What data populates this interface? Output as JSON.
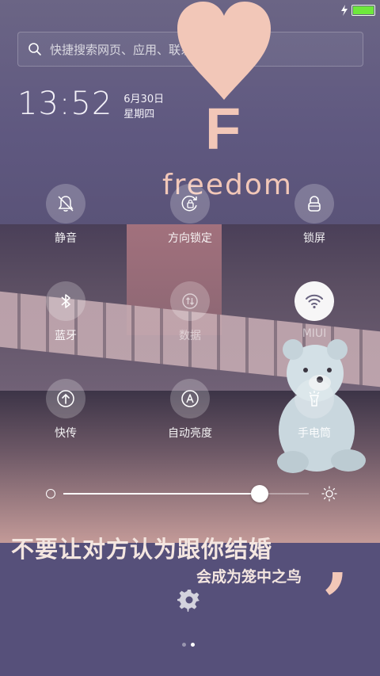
{
  "search": {
    "placeholder": "快捷搜索网页、应用、联系人、视频..."
  },
  "clock": {
    "time": "13:52",
    "date": "6月30日",
    "weekday": "星期四"
  },
  "wallpaper": {
    "letter": "F",
    "word": "freedom",
    "quote_line1": "不要让对方认为跟你结婚",
    "quote_line2": "会成为笼中之鸟",
    "quote_mark": ","
  },
  "toggles": [
    {
      "label": "静音",
      "icon": "bell-off-icon",
      "active": false
    },
    {
      "label": "方向锁定",
      "icon": "rotation-lock-icon",
      "active": false
    },
    {
      "label": "锁屏",
      "icon": "lock-icon",
      "active": false
    },
    {
      "label": "蓝牙",
      "icon": "bluetooth-icon",
      "active": false
    },
    {
      "label": "数据",
      "icon": "data-arrows-icon",
      "active": false
    },
    {
      "label": "MIUI",
      "icon": "wifi-icon",
      "active": true
    },
    {
      "label": "快传",
      "icon": "upload-arrow-icon",
      "active": false
    },
    {
      "label": "自动亮度",
      "icon": "auto-brightness-icon",
      "active": false
    },
    {
      "label": "手电筒",
      "icon": "flashlight-icon",
      "active": false
    }
  ],
  "brightness": {
    "level": 0.8
  },
  "pager": {
    "total": 2,
    "current": 2
  },
  "colors": {
    "accent_peach": "#f2c7b8",
    "battery_green": "#6ee83c",
    "background": "#5b5478"
  }
}
